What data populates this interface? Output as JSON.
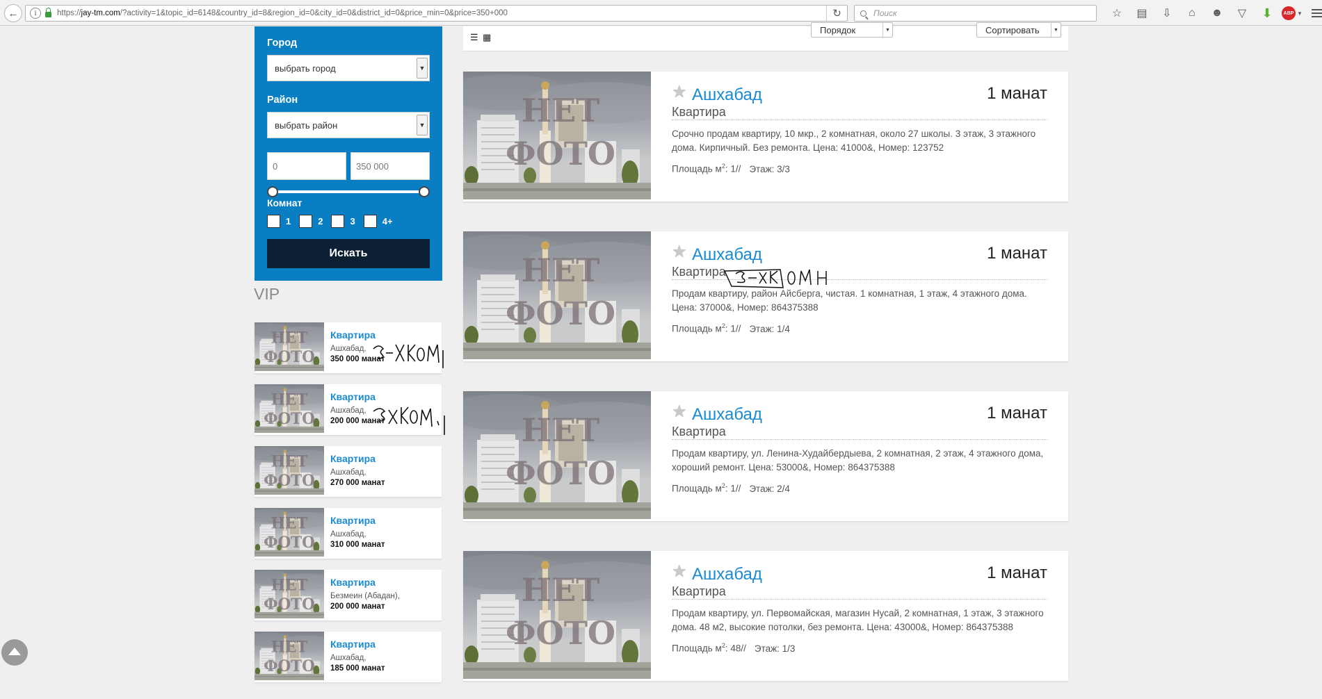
{
  "browser": {
    "url_prefix": "https://",
    "url_host": "jay-tm.com",
    "url_path": "/?activity=1&topic_id=6148&country_id=8&region_id=0&city_id=0&district_id=0&price_min=0&price=350+000",
    "search_placeholder": "Поиск"
  },
  "filter": {
    "city_label": "Город",
    "city_value": "выбрать город",
    "district_label": "Район",
    "district_value": "выбрать район",
    "price_min": "0",
    "price_max": "350 000",
    "price_range_fraction": [
      0,
      1
    ],
    "rooms_label": "Комнат",
    "rooms": [
      "1",
      "2",
      "3",
      "4+"
    ],
    "search_button": "Искать"
  },
  "sort_bar": {
    "order_label": "Порядок",
    "sort_label": "Сортировать"
  },
  "vip": {
    "title": "VIP",
    "photo_text": [
      "НЕТ",
      "ФОТО"
    ],
    "items": [
      {
        "type": "Квартира",
        "city": "Ашхабад,",
        "price": "350 000 манат"
      },
      {
        "type": "Квартира",
        "city": "Ашхабад,",
        "price": "200 000 манат"
      },
      {
        "type": "Квартира",
        "city": "Ашхабад,",
        "price": "270 000 манат"
      },
      {
        "type": "Квартира",
        "city": "Ашхабад,",
        "price": "310 000 манат"
      },
      {
        "type": "Квартира",
        "city": "Безмеин (Абадан),",
        "price": "200 000 манат"
      },
      {
        "type": "Квартира",
        "city": "Ашхабад,",
        "price": "185 000 манат"
      }
    ]
  },
  "listings": {
    "photo_text": [
      "НЕТ",
      "ФОТО"
    ],
    "items": [
      {
        "city": "Ашхабад",
        "type": "Квартира",
        "price": "1 манат",
        "description": "Срочно продам квартиру, 10 мкр., 2 комнатная, около 27 школы. 3 этаж, 3 этажного дома. Кирпичный. Без ремонта. Цена: 41000&, Номер: 123752",
        "area_label": "Площадь м",
        "area_sup": "2",
        "area_value": ": 1//",
        "floor": "Этаж: 3/3"
      },
      {
        "city": "Ашхабад",
        "type": "Квартира",
        "price": "1 манат",
        "description": "Продам квартиру, район Айсберга, чистая. 1 комнатная, 1 этаж, 4 этажного дома. Цена: 37000&, Номер: 864375388",
        "area_label": "Площадь м",
        "area_sup": "2",
        "area_value": ": 1//",
        "floor": "Этаж: 1/4"
      },
      {
        "city": "Ашхабад",
        "type": "Квартира",
        "price": "1 манат",
        "description": "Продам квартиру, ул. Ленина-Худайбердыева, 2 комнатная, 2 этаж, 4 этажного дома, хороший ремонт. Цена: 53000&, Номер: 864375388",
        "area_label": "Площадь м",
        "area_sup": "2",
        "area_value": ": 1//",
        "floor": "Этаж: 2/4"
      },
      {
        "city": "Ашхабад",
        "type": "Квартира",
        "price": "1 манат",
        "description": "Продам квартиру, ул. Первомайская, магазин Нусай, 2 комнатная, 1 этаж, 3 этажного дома. 48 м2, высокие потолки, без ремонта. Цена: 43000&, Номер: 864375388",
        "area_label": "Площадь м",
        "area_sup": "2",
        "area_value": ": 48//",
        "floor": "Этаж: 1/3"
      }
    ]
  },
  "colors": {
    "filter_bg": "#0a7ec2",
    "link": "#1a8ad3",
    "search_button_bg": "#0c1f33",
    "page_bg": "#efefef"
  }
}
